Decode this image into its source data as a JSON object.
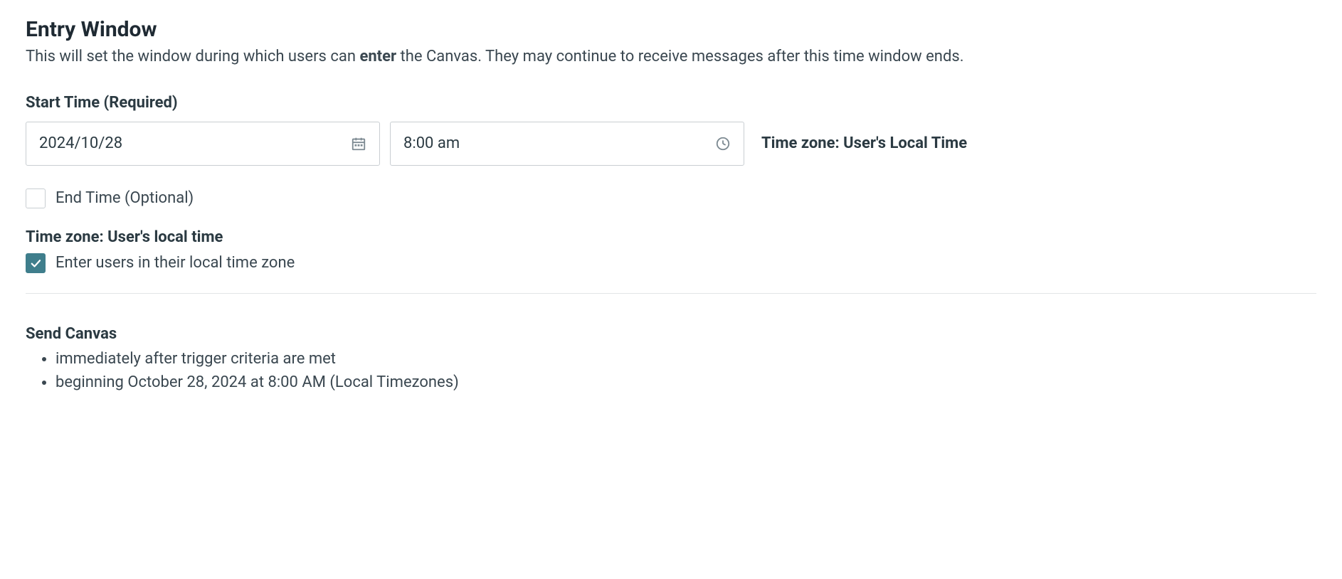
{
  "header": {
    "title": "Entry Window",
    "description_pre": "This will set the window during which users can ",
    "description_bold": "enter",
    "description_post": " the Canvas. They may continue to receive messages after this time window ends."
  },
  "start_time": {
    "label": "Start Time (Required)",
    "date_value": "2024/10/28",
    "time_value": "8:00 am",
    "timezone_label": "Time zone: User's Local Time"
  },
  "end_time": {
    "checked": false,
    "label": "End Time (Optional)"
  },
  "timezone_section": {
    "heading": "Time zone: User's local time",
    "checkbox_checked": true,
    "checkbox_label": "Enter users in their local time zone"
  },
  "summary": {
    "title": "Send Canvas",
    "items": [
      "immediately after trigger criteria are met",
      "beginning October 28, 2024 at 8:00 AM (Local Timezones)"
    ]
  }
}
